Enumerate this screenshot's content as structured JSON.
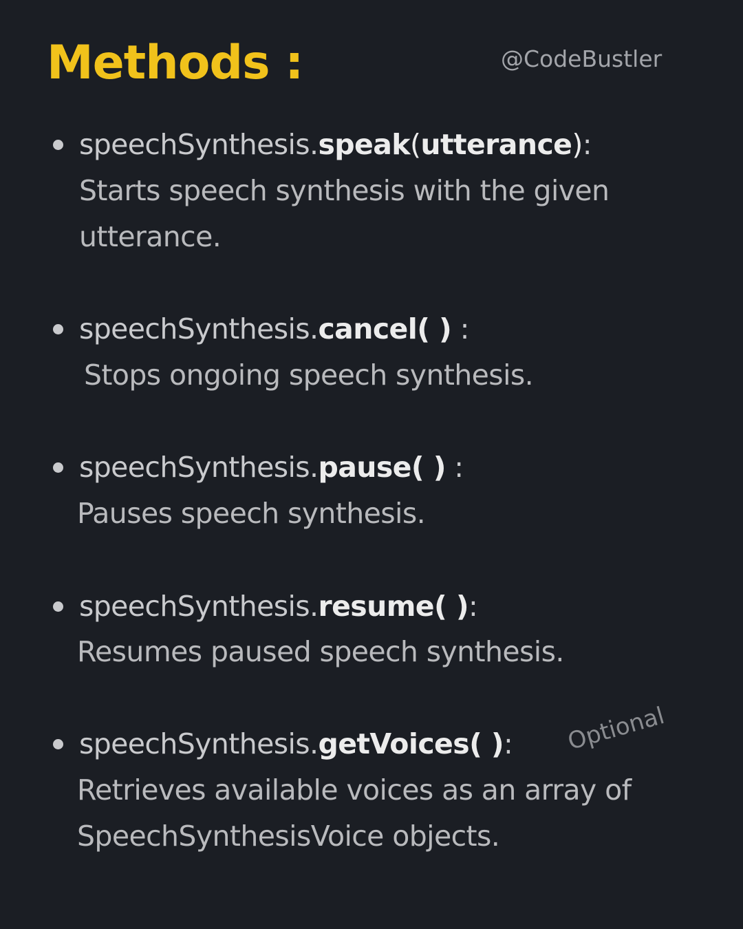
{
  "header": {
    "title": "Methods :",
    "handle": "@CodeBustler"
  },
  "methods": [
    {
      "object": "speechSynthesis.",
      "name": "speak",
      "open_paren": "(",
      "param": "utterance",
      "close_paren": ")",
      "colon": ":",
      "description_line1": "Starts speech synthesis with the given",
      "description_line2": "utterance."
    },
    {
      "object": "speechSynthesis.",
      "name": "cancel",
      "parens": "( )",
      "colon": " :",
      "description_line1": "Stops ongoing speech synthesis."
    },
    {
      "object": "speechSynthesis.",
      "name": "pause",
      "parens": "( )",
      "colon": " :",
      "description_line1": "Pauses speech synthesis."
    },
    {
      "object": "speechSynthesis.",
      "name": "resume",
      "parens": "( )",
      "colon": ":",
      "description_line1": "Resumes paused speech synthesis."
    },
    {
      "object": "speechSynthesis.",
      "name": "getVoices",
      "parens": "( )",
      "colon": ":",
      "tag": "Optional",
      "description_line1": "Retrieves available voices as an array of",
      "description_line2": "SpeechSynthesisVoice objects."
    }
  ],
  "colors": {
    "background": "#1b1e24",
    "title": "#f1c21b",
    "method": "#ececec",
    "text": "#c9cacd",
    "handle": "#a3a5aa"
  }
}
